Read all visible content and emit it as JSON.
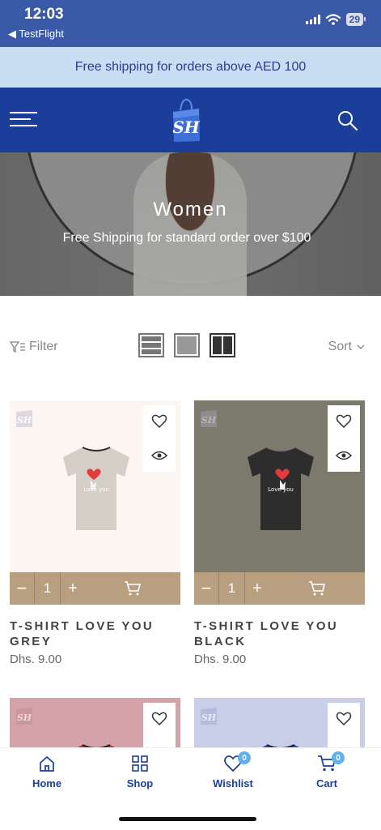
{
  "status_bar": {
    "time": "12:03",
    "back_app": "◀ TestFlight",
    "battery": "29"
  },
  "promo": {
    "text": "Free shipping for orders above AED 100"
  },
  "header": {
    "logo_text": "SH",
    "menu_icon": "hamburger-icon",
    "search_icon": "search-icon"
  },
  "hero": {
    "title": "Women",
    "subtitle": "Free Shipping for standard order over $100"
  },
  "toolbar": {
    "filter_label": "Filter",
    "sort_label": "Sort"
  },
  "products": [
    {
      "name": "T-SHIRT LOVE YOU GREY",
      "price": "Dhs. 9.00",
      "qty": "1",
      "bg": "#fbf6f2",
      "shirt_color": "#d3cec6",
      "text_color": "#ffffff",
      "print": "Love   you"
    },
    {
      "name": "T-SHIRT LOVE YOU BLACK",
      "price": "Dhs. 9.00",
      "qty": "1",
      "bg": "#7c7a6c",
      "shirt_color": "#2d2d2d",
      "text_color": "#ffffff",
      "print": "Love   you"
    },
    {
      "bg": "#d4a3a7",
      "shirt_color": "#e31e24"
    },
    {
      "bg": "#c8cde8",
      "shirt_color": "#1f4fd1"
    }
  ],
  "qty_controls": {
    "minus": "−",
    "plus": "+"
  },
  "bottom_nav": {
    "home": "Home",
    "shop": "Shop",
    "wishlist": "Wishlist",
    "wishlist_count": "0",
    "cart": "Cart",
    "cart_count": "0"
  },
  "colors": {
    "header": "#1c3e9b",
    "promo_bg": "#c9ddf3",
    "qty_bar": "#b89f80",
    "badge": "#5fb1ef"
  }
}
